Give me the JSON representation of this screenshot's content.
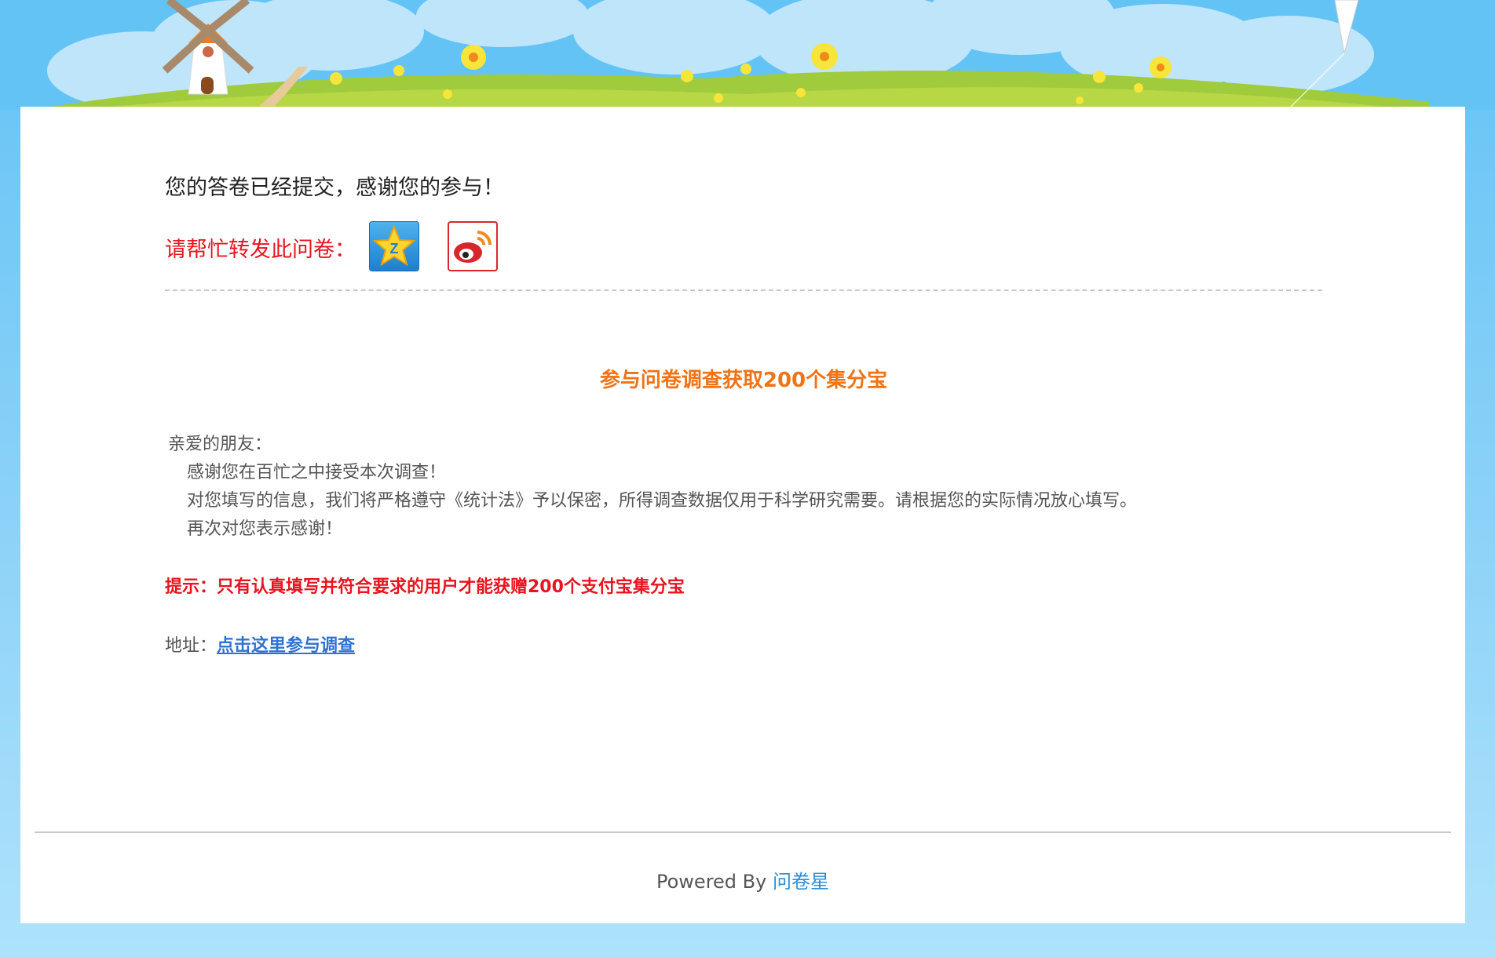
{
  "banner": {
    "scene": "windmill-meadow-illustration",
    "sky_color": "#64c3f5",
    "grass_color": "#9fcb3c",
    "icons": [
      "windmill-icon",
      "flower-icon",
      "kite-icon",
      "cloud-icon"
    ]
  },
  "result": {
    "thanks_text": "您的答卷已经提交，感谢您的参与！",
    "share_label": "请帮忙转发此问卷：",
    "share_buttons": [
      {
        "name": "qzone",
        "icon": "qzone-star-icon",
        "color": "#1f7fd0"
      },
      {
        "name": "weibo",
        "icon": "weibo-icon",
        "color": "#d7262d"
      }
    ]
  },
  "survey": {
    "title": "参与问卷调查获取200个集分宝",
    "title_color": "#f07314",
    "greeting": "亲爱的朋友：",
    "paragraphs": [
      "感谢您在百忙之中接受本次调查！",
      "对您填写的信息，我们将严格遵守《统计法》予以保密，所得调查数据仅用于科学研究需要。请根据您的实际情况放心填写。",
      "再次对您表示感谢！"
    ],
    "tip": "提示：只有认真填写并符合要求的用户才能获赠200个支付宝集分宝",
    "tip_color": "#e8141f",
    "address_label": "地址：",
    "address_link": "点击这里参与调查",
    "link_color": "#2f73d0"
  },
  "footer": {
    "powered_by": "Powered By",
    "brand_link": "问卷星",
    "brand_color": "#2b8fd8"
  }
}
